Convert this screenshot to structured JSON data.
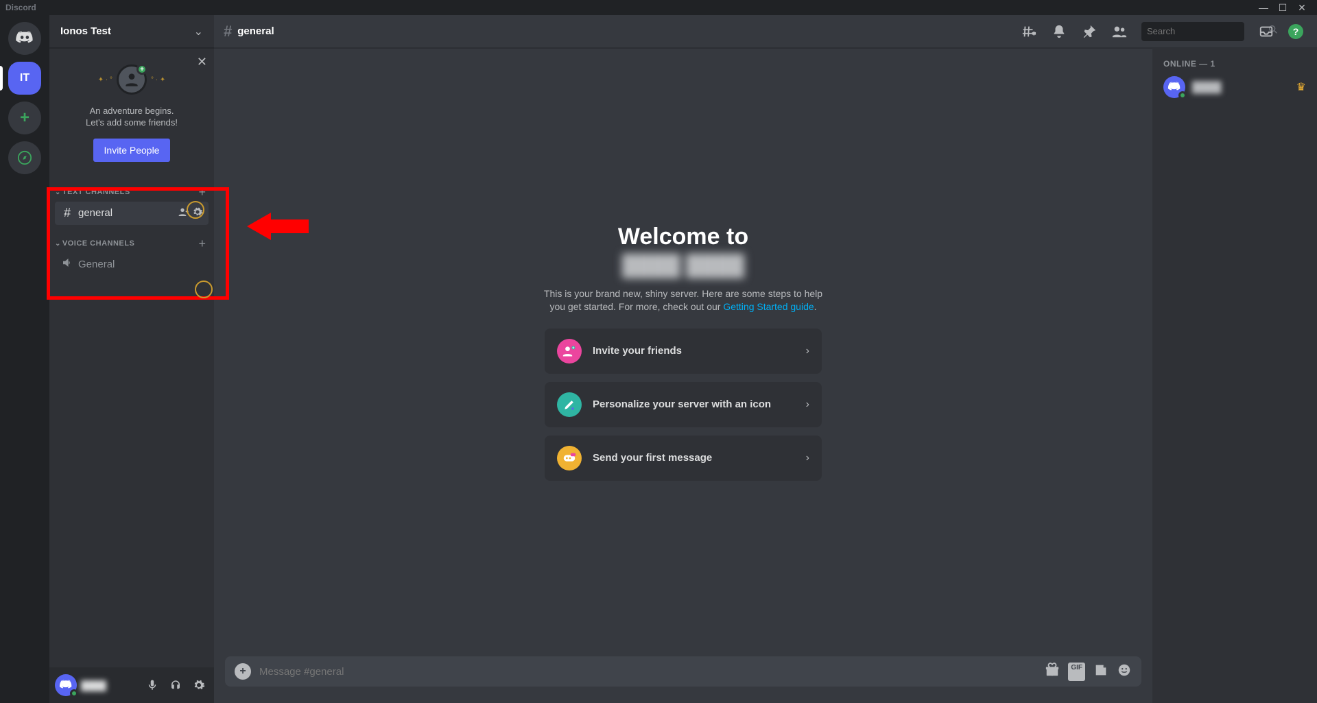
{
  "titlebar": {
    "brand": "Discord"
  },
  "rail": {
    "server_initials": "IT"
  },
  "sidebar": {
    "server_name": "Ionos Test",
    "invite": {
      "line1": "An adventure begins.",
      "line2": "Let's add some friends!",
      "button": "Invite People"
    },
    "groups": {
      "text_label": "TEXT CHANNELS",
      "voice_label": "VOICE CHANNELS",
      "text_channels": [
        {
          "name": "general",
          "active": true
        }
      ],
      "voice_channels": [
        {
          "name": "General"
        }
      ]
    },
    "user": {
      "name": "████"
    }
  },
  "header": {
    "channel": "general",
    "search_placeholder": "Search"
  },
  "welcome": {
    "title": "Welcome to",
    "server_name": "████ ████",
    "blurb_a": "This is your brand new, shiny server. Here are some steps to help you get started. For more, check out our ",
    "blurb_link": "Getting Started guide",
    "blurb_b": ".",
    "cards": [
      {
        "label": "Invite your friends"
      },
      {
        "label": "Personalize your server with an icon"
      },
      {
        "label": "Send your first message"
      }
    ]
  },
  "composer": {
    "placeholder": "Message #general"
  },
  "members": {
    "header": "ONLINE — 1",
    "list": [
      {
        "name": "████"
      }
    ]
  }
}
